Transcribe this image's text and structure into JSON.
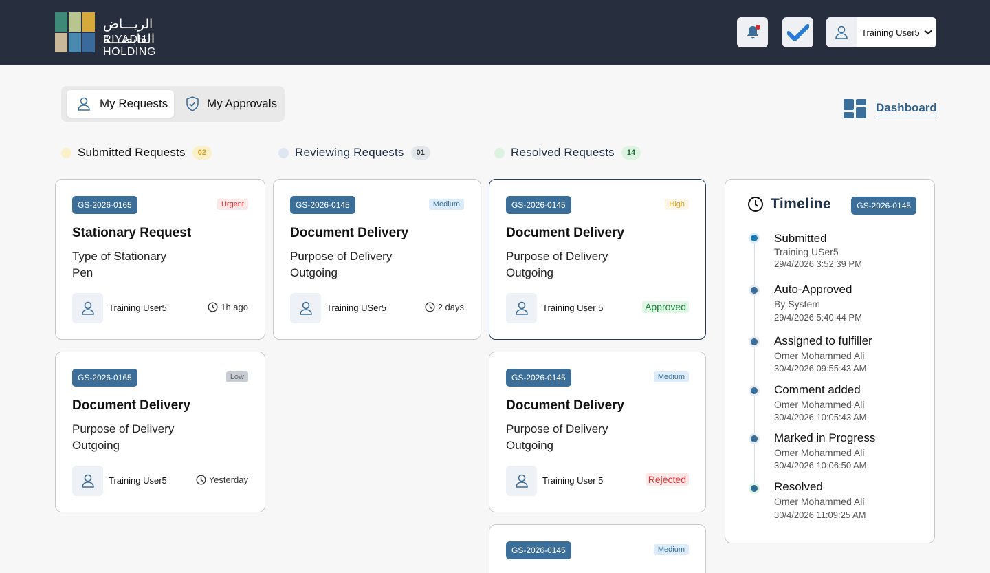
{
  "header": {
    "logo_text_arabic": "الريـــاض القابضـــة",
    "logo_text": "RIYADH HOLDING",
    "user_name": "Training User5"
  },
  "tabs": [
    {
      "label": "My Requests",
      "active": true
    },
    {
      "label": "My Approvals",
      "active": false
    }
  ],
  "dashboard_link": "Dashboard",
  "columns": [
    {
      "title": "Submitted Requests",
      "count": "02",
      "dot_color": "#fbf1c8",
      "count_bg": "#fbf1c8",
      "count_color": "#d49a1a"
    },
    {
      "title": "Reviewing Requests",
      "count": "01",
      "dot_color": "#dde6f1",
      "count_bg": "#e2e6ea",
      "count_color": "#333333"
    },
    {
      "title": "Resolved Requests",
      "count": "14",
      "dot_color": "#dcf3e1",
      "count_bg": "#dcf3e1",
      "count_color": "#1b6d34"
    }
  ],
  "cards": {
    "submitted": [
      {
        "id": "GS-2026-0165",
        "priority": "Urgent",
        "title": "Stationary Request",
        "field": "Type of Stationary",
        "value": "Pen",
        "user": "Training User5",
        "time": "1h ago"
      },
      {
        "id": "GS-2026-0165",
        "priority": "Low",
        "title": "Document Delivery",
        "field": "Purpose of Delivery",
        "value": "Outgoing",
        "user": "Training User5",
        "time": "Yesterday"
      }
    ],
    "reviewing": [
      {
        "id": "GS-2026-0145",
        "priority": "Medium",
        "title": "Document Delivery",
        "field": "Purpose of Delivery",
        "value": "Outgoing",
        "user": "Training USer5",
        "time": "2 days"
      }
    ],
    "resolved": [
      {
        "id": "GS-2026-0145",
        "priority": "High",
        "title": "Document Delivery",
        "field": "Purpose of Delivery",
        "value": "Outgoing",
        "user": "Training User 5",
        "status": "Approved"
      },
      {
        "id": "GS-2026-0145",
        "priority": "Medium",
        "title": "Document Delivery",
        "field": "Purpose of Delivery",
        "value": "Outgoing",
        "user": "Training User 5",
        "status": "Rejected"
      },
      {
        "id": "GS-2026-0145",
        "priority": "Medium"
      }
    ]
  },
  "timeline": {
    "title": "Timeline",
    "request_id": "GS-2026-0145",
    "events": [
      {
        "event": "Submitted",
        "by": "Training USer5",
        "at": "29/4/2026 3:52:39 PM",
        "dot": "#1d78b0",
        "halo": "#dcecf7"
      },
      {
        "event": "Auto-Approved",
        "by": "By System",
        "at": "29/4/2026 5:40:44 PM",
        "dot": "#3c6e9a",
        "halo": "#e6ebf0"
      },
      {
        "event": "Assigned to fulfiller",
        "by": "Omer Mohammed Ali",
        "at": "30/4/2026 09:55:43 AM",
        "dot": "#3c6e9a",
        "halo": "#e6ebf0"
      },
      {
        "event": "Comment added",
        "by": "Omer Mohammed Ali",
        "at": "30/4/2026 10:05:43 AM",
        "dot": "#3c6e9a",
        "halo": "#e6ebf0"
      },
      {
        "event": "Marked in Progress",
        "by": "Omer Mohammed Ali",
        "at": "30/4/2026 10:06:50 AM",
        "dot": "#3c6e9a",
        "halo": "#e6ebf0"
      },
      {
        "event": "Resolved",
        "by": "Omer Mohammed Ali",
        "at": "30/4/2026 11:09:25 AM",
        "dot": "#2e6e8f",
        "halo": "#ddf3e3"
      }
    ]
  }
}
